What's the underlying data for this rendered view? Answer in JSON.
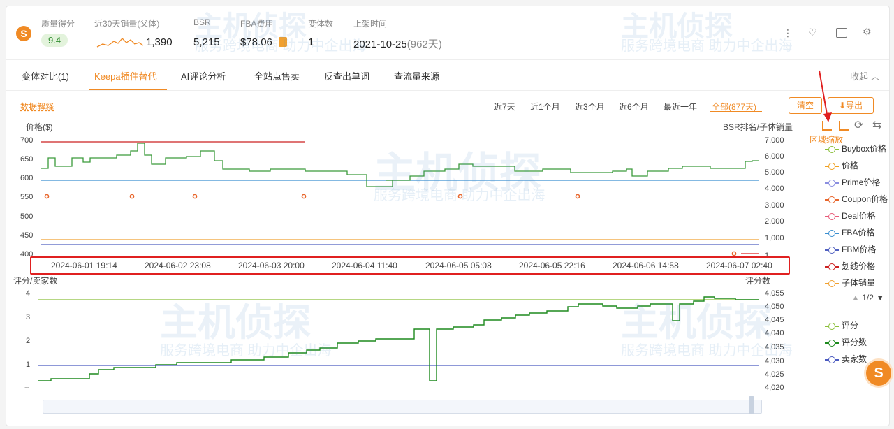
{
  "header": {
    "stats": [
      {
        "label": "质量得分",
        "value": "9.4"
      },
      {
        "label": "近30天销量(父体)",
        "value": "1,390"
      },
      {
        "label": "BSR",
        "value": "5,215"
      },
      {
        "label": "FBA费用",
        "value": "$78.06"
      },
      {
        "label": "变体数",
        "value": "1"
      },
      {
        "label": "上架时间",
        "value": "2021-10-25",
        "extra": "(962天)"
      }
    ],
    "logo_text": "S"
  },
  "tabs": [
    "变体对比(1)",
    "Keepa插件替代",
    "AI评论分析",
    "全站点售卖",
    "反查出单词",
    "查流量来源"
  ],
  "collapse_label": "收起",
  "toolbar": {
    "explain_link": "数据解释",
    "ranges": [
      "近7天",
      "近1个月",
      "近3个月",
      "近6个月",
      "最近一年",
      "全部(877天)"
    ],
    "clear_label": "清空",
    "export_label": "导出",
    "zoom_label": "区域缩放"
  },
  "chart_top": {
    "left_axis_title": "价格($)",
    "right_axis_title": "BSR排名/子体销量",
    "left_ticks": [
      "700",
      "650",
      "600",
      "550",
      "500",
      "450",
      "400"
    ],
    "right_ticks": [
      "7,000",
      "6,000",
      "5,000",
      "4,000",
      "3,000",
      "2,000",
      "1,000",
      "1"
    ],
    "x_ticks": [
      "2024-06-01 19:14",
      "2024-06-02 23:08",
      "2024-06-03 20:00",
      "2024-06-04 11:40",
      "2024-06-05 05:08",
      "2024-06-05 22:16",
      "2024-06-06 14:58",
      "2024-06-07 02:40"
    ]
  },
  "chart_bottom": {
    "left_axis_title": "评分/卖家数",
    "right_axis_title": "评分数",
    "left_ticks": [
      "4",
      "3",
      "2",
      "1",
      "--"
    ],
    "right_ticks": [
      "4,055",
      "4,050",
      "4,045",
      "4,040",
      "4,035",
      "4,030",
      "4,025",
      "4,020"
    ]
  },
  "legend_top": [
    {
      "name": "Buybox价格",
      "color": "#8bbf3a"
    },
    {
      "name": "价格",
      "color": "#f0a020"
    },
    {
      "name": "Prime价格",
      "color": "#8b8fe0"
    },
    {
      "name": "Coupon价格",
      "color": "#e8662c"
    },
    {
      "name": "Deal价格",
      "color": "#e85c7a"
    },
    {
      "name": "FBA价格",
      "color": "#3b8fd0"
    },
    {
      "name": "FBM价格",
      "color": "#5060c0"
    },
    {
      "name": "划线价格",
      "color": "#cc2222"
    },
    {
      "name": "子体销量",
      "color": "#f0a030"
    }
  ],
  "legend_pager": "1/2",
  "legend_bottom": [
    {
      "name": "评分",
      "color": "#8bbf3a"
    },
    {
      "name": "评分数",
      "color": "#1e8a1e"
    },
    {
      "name": "卖家数",
      "color": "#4a5ac0"
    }
  ],
  "watermarks": {
    "brand": "主机侦探",
    "slogan": "服务跨境电商 助力中企出海"
  }
}
